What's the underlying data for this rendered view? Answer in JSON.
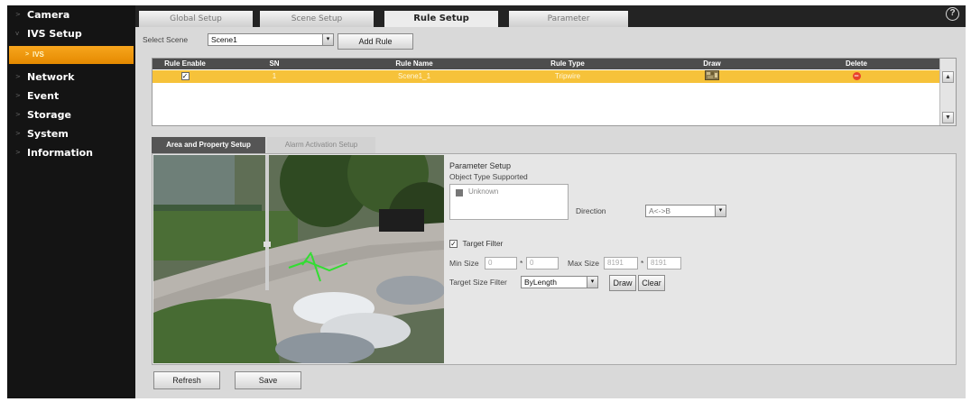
{
  "sidebar": {
    "items": [
      {
        "label": "Camera",
        "arrow": ">"
      },
      {
        "label": "IVS Setup",
        "arrow": "v"
      },
      {
        "label": "Network",
        "arrow": ">"
      },
      {
        "label": "Event",
        "arrow": ">"
      },
      {
        "label": "Storage",
        "arrow": ">"
      },
      {
        "label": "System",
        "arrow": ">"
      },
      {
        "label": "Information",
        "arrow": ">"
      }
    ],
    "subitem": {
      "label": "IVS",
      "arrow": ">"
    }
  },
  "tabs": [
    "Global Setup",
    "Scene Setup",
    "Rule Setup",
    "Parameter"
  ],
  "help_icon_glyph": "?",
  "scene": {
    "label": "Select Scene",
    "value": "Scene1",
    "add_rule_label": "Add Rule"
  },
  "rules": {
    "headers": [
      "Rule Enable",
      "SN",
      "Rule Name",
      "Rule Type",
      "Draw",
      "Delete"
    ],
    "rows": [
      {
        "enabled_mark": "✓",
        "sn": "1",
        "name": "Scene1_1",
        "type": "Tripwire"
      }
    ],
    "delete_glyph": "−",
    "scroll_up": "▲",
    "scroll_down": "▼"
  },
  "subtabs": [
    "Area and Property Setup",
    "Alarm Activation Setup"
  ],
  "params": {
    "title": "Parameter Setup",
    "object_type_label": "Object Type Supported",
    "object_type_value": "Unknown",
    "object_type_mark": "■",
    "direction_label": "Direction",
    "direction_value": "A<->B",
    "target_filter_label": "Target Filter",
    "target_filter_mark": "✓",
    "min_size_label": "Min Size",
    "min_w": "0",
    "min_h": "0",
    "max_size_label": "Max Size",
    "max_w": "8191",
    "max_h": "8191",
    "size_sep": "*",
    "target_size_filter_label": "Target Size Filter",
    "target_size_filter_value": "ByLength",
    "draw_label": "Draw",
    "clear_label": "Clear"
  },
  "dropdown_glyph": "▾",
  "footer": {
    "refresh_label": "Refresh",
    "save_label": "Save"
  },
  "colors": {
    "sidebar_bg": "#141414",
    "accent_orange": "#f0a020",
    "row_highlight": "#f6c23a",
    "table_header": "#4d4d4d",
    "tripwire_green": "#33dd33"
  }
}
